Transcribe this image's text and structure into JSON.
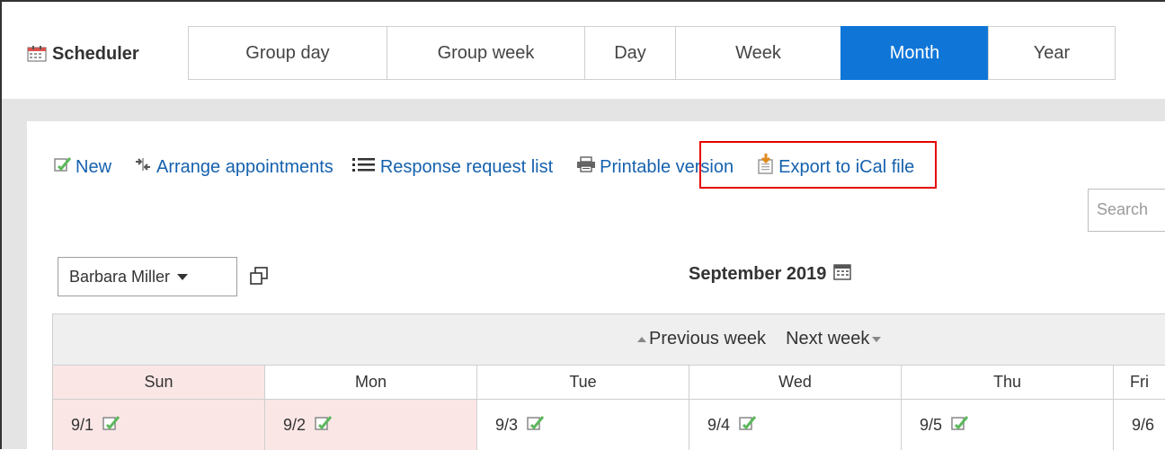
{
  "app": {
    "title": "Scheduler",
    "icon": "calendar-icon"
  },
  "tabs": [
    {
      "label": "Group day",
      "active": false
    },
    {
      "label": "Group week",
      "active": false
    },
    {
      "label": "Day",
      "active": false
    },
    {
      "label": "Week",
      "active": false
    },
    {
      "label": "Month",
      "active": true
    },
    {
      "label": "Year",
      "active": false
    }
  ],
  "toolbar": {
    "new": "New",
    "arrange": "Arrange appointments",
    "response": "Response request list",
    "printable": "Printable version",
    "export": "Export to iCal file"
  },
  "search": {
    "placeholder": "Search"
  },
  "user_select": {
    "value": "Barbara Miller"
  },
  "calendar": {
    "month_title": "September 2019",
    "prev_week": "Previous week",
    "next_week": "Next week",
    "days": [
      "Sun",
      "Mon",
      "Tue",
      "Wed",
      "Thu",
      "Fri"
    ],
    "dates": [
      "9/1",
      "9/2",
      "9/3",
      "9/4",
      "9/5",
      "9/6"
    ]
  },
  "colors": {
    "accent": "#0f76d8",
    "link": "#1561ae",
    "highlight": "#e50000",
    "sunday": "#fbe6e6"
  }
}
